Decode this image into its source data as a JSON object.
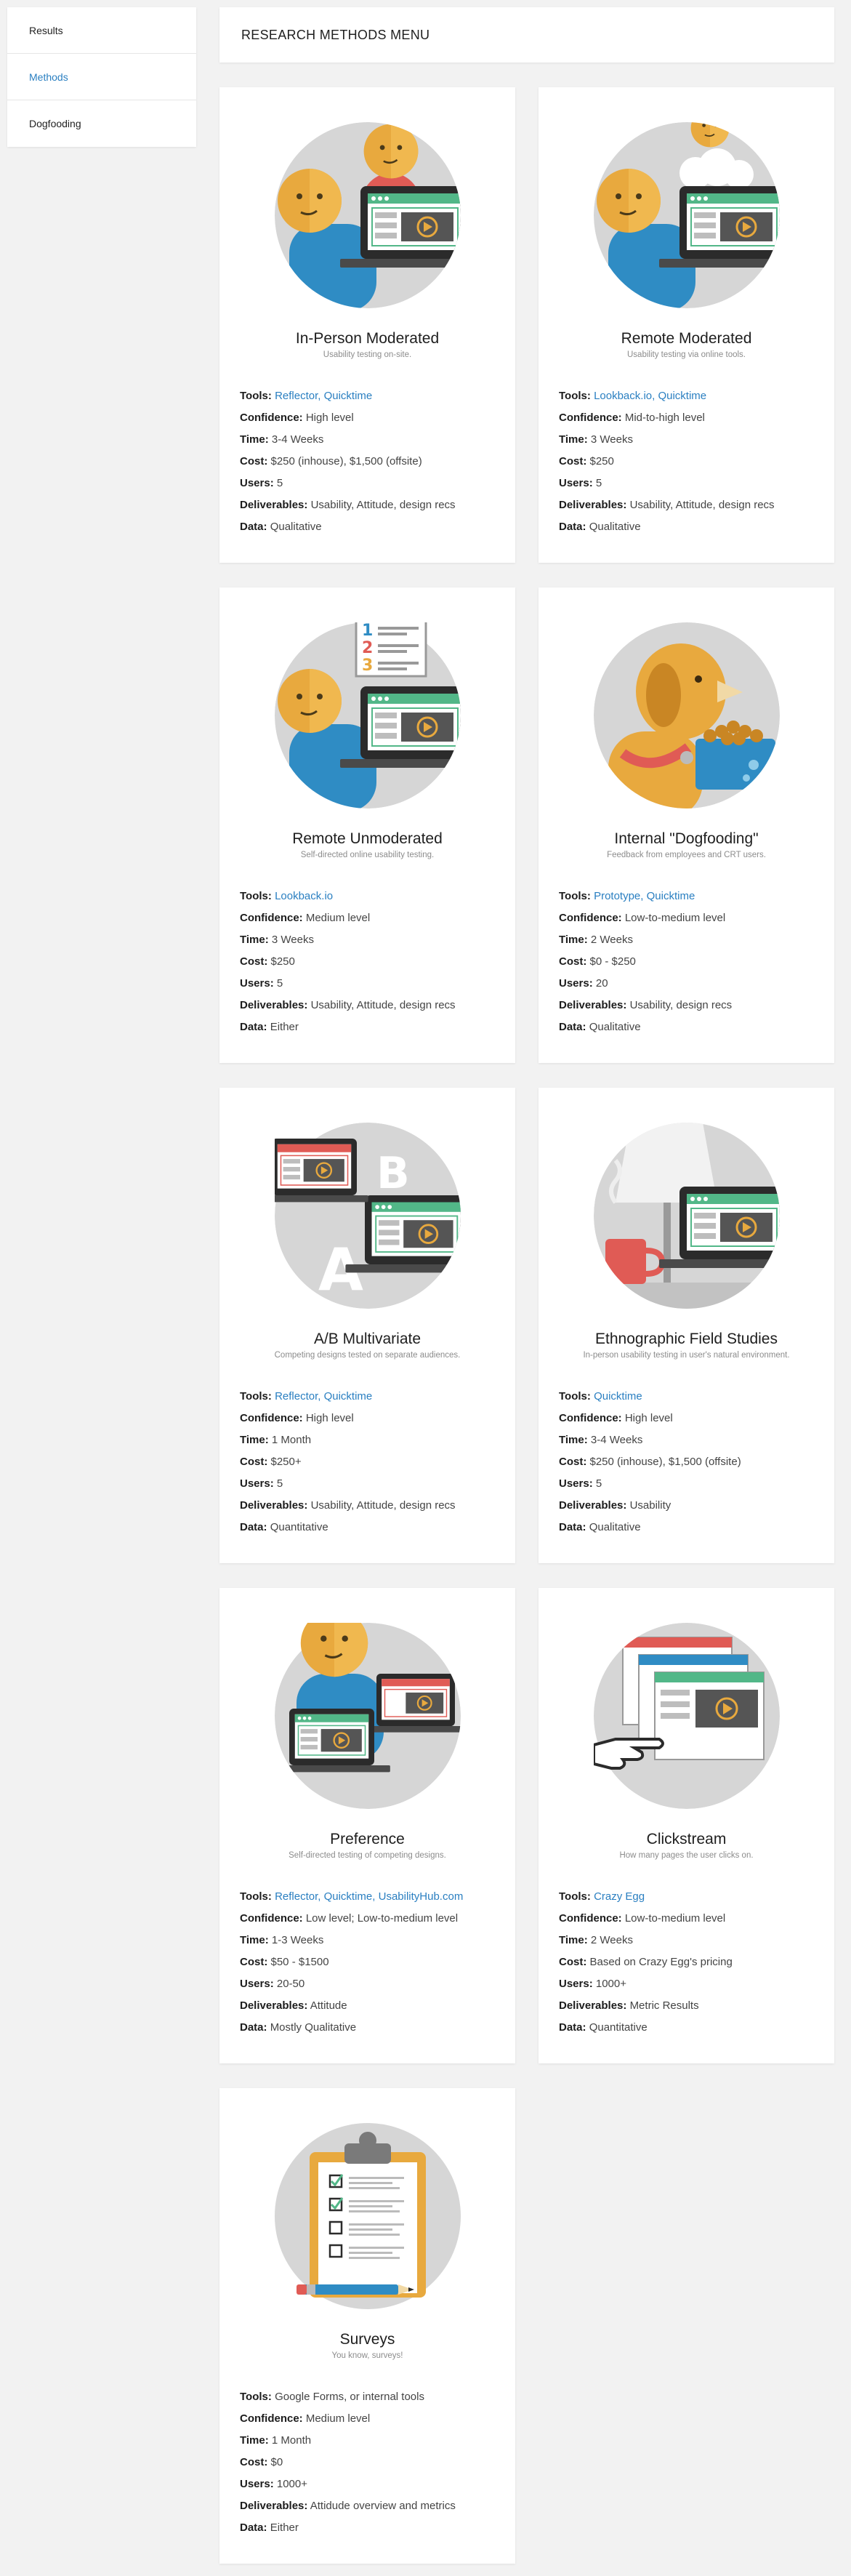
{
  "sidebar": {
    "items": [
      {
        "label": "Results",
        "active": false
      },
      {
        "label": "Methods",
        "active": true
      },
      {
        "label": "Dogfooding",
        "active": false
      }
    ]
  },
  "header": {
    "title": "RESEARCH METHODS MENU"
  },
  "labels": {
    "tools": "Tools:",
    "confidence": "Confidence:",
    "time": "Time:",
    "cost": "Cost:",
    "users": "Users:",
    "deliverables": "Deliverables:",
    "data": "Data:"
  },
  "colors": {
    "accent": "#2a7fc1",
    "skin": "#e8a93e",
    "shirt": "#2f8cc4",
    "screen_green": "#52b788",
    "red": "#e05b55"
  },
  "cards": [
    {
      "title": "In-Person Moderated",
      "subtitle": "Usability testing on-site.",
      "tools": "Reflector, Quicktime",
      "tools_link": true,
      "confidence": "High level",
      "time": "3-4 Weeks",
      "cost": "$250 (inhouse), $1,500 (offsite)",
      "users": "5",
      "deliverables": "Usability, Attitude, design recs",
      "data": "Qualitative",
      "icon": "in-person-moderated-illustration"
    },
    {
      "title": "Remote Moderated",
      "subtitle": "Usability testing via online tools.",
      "tools": "Lookback.io, Quicktime",
      "tools_link": true,
      "confidence": "Mid-to-high level",
      "time": "3 Weeks",
      "cost": "$250",
      "users": "5",
      "deliverables": "Usability, Attitude, design recs",
      "data": "Qualitative",
      "icon": "remote-moderated-illustration"
    },
    {
      "title": "Remote Unmoderated",
      "subtitle": "Self-directed online usability testing.",
      "tools": "Lookback.io",
      "tools_link": true,
      "confidence": "Medium level",
      "time": "3 Weeks",
      "cost": "$250",
      "users": "5",
      "deliverables": "Usability, Attitude, design recs",
      "data": "Either",
      "icon": "remote-unmoderated-illustration"
    },
    {
      "title": "Internal \"Dogfooding\"",
      "subtitle": "Feedback from employees and CRT users.",
      "tools": "Prototype, Quicktime",
      "tools_link": true,
      "confidence": "Low-to-medium level",
      "time": "2 Weeks",
      "cost": "$0 - $250",
      "users": "20",
      "deliverables": "Usability, design recs",
      "data": "Qualitative",
      "icon": "dog-icon"
    },
    {
      "title": "A/B Multivariate",
      "subtitle": "Competing designs tested on separate audiences.",
      "tools": "Reflector, Quicktime",
      "tools_link": true,
      "confidence": "High level",
      "time": "1 Month",
      "cost": "$250+",
      "users": "5",
      "deliverables": "Usability, Attitude, design recs",
      "data": "Quantitative",
      "icon": "ab-test-illustration"
    },
    {
      "title": "Ethnographic Field Studies",
      "subtitle": "In-person usability testing in user's natural environment.",
      "tools": "Quicktime",
      "tools_link": true,
      "confidence": "High level",
      "time": "3-4 Weeks",
      "cost": "$250 (inhouse), $1,500 (offsite)",
      "users": "5",
      "deliverables": "Usability",
      "data": "Qualitative",
      "icon": "ethnographic-illustration"
    },
    {
      "title": "Preference",
      "subtitle": "Self-directed testing of competing designs.",
      "tools": "Reflector, Quicktime, UsabilityHub.com",
      "tools_link": true,
      "confidence": "Low level; Low-to-medium level",
      "time": "1-3 Weeks",
      "cost": "$50 - $1500",
      "users": "20-50",
      "deliverables": "Attitude",
      "data": "Mostly Qualitative",
      "icon": "preference-illustration"
    },
    {
      "title": "Clickstream",
      "subtitle": "How many pages the user clicks on.",
      "tools": "Crazy Egg",
      "tools_link": true,
      "confidence": "Low-to-medium level",
      "time": "2 Weeks",
      "cost": "Based on Crazy Egg's pricing",
      "users": "1000+",
      "deliverables": "Metric Results",
      "data": "Quantitative",
      "icon": "clickstream-illustration"
    },
    {
      "title": "Surveys",
      "subtitle": "You know, surveys!",
      "tools": "Google Forms, or internal tools",
      "tools_link": false,
      "confidence": "Medium level",
      "time": "1 Month",
      "cost": "$0",
      "users": "1000+",
      "deliverables": "Attidude overview and metrics",
      "data": "Either",
      "icon": "clipboard-survey-illustration"
    }
  ]
}
